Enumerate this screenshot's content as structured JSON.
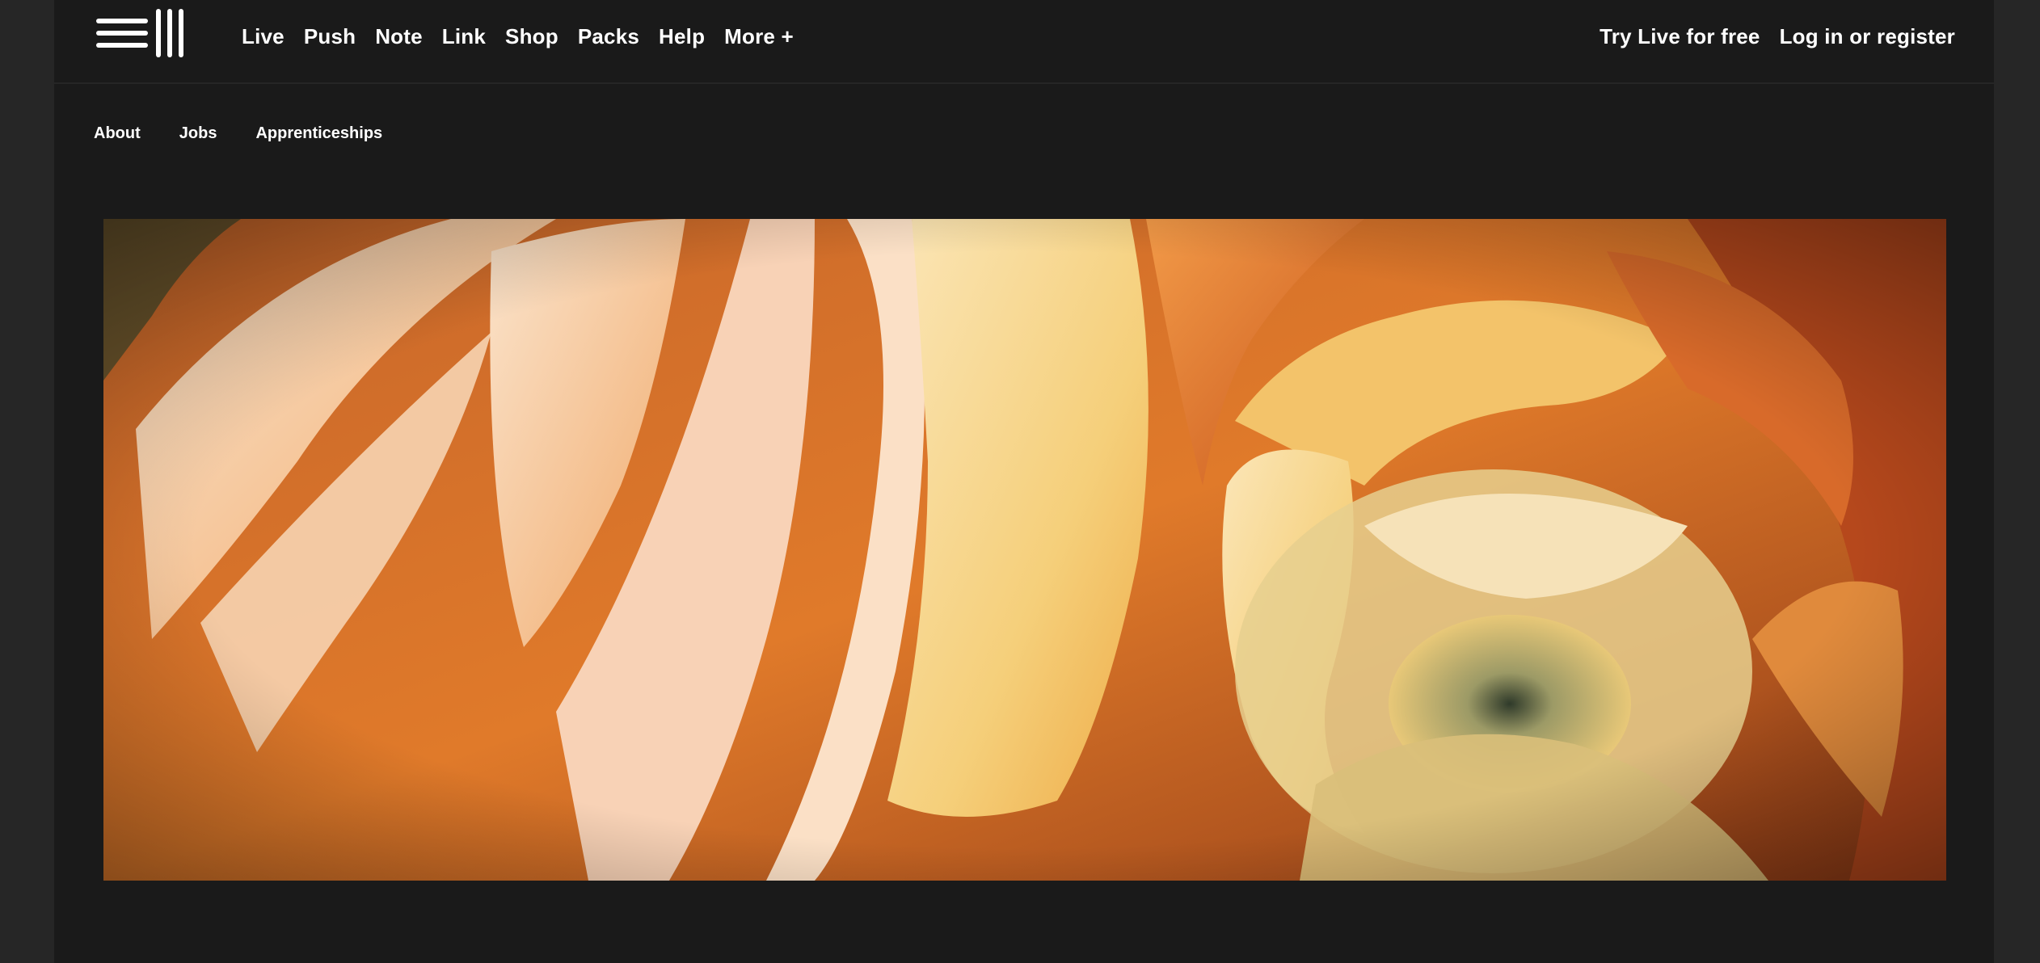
{
  "header": {
    "logo_icon": "ableton-logo-icon",
    "nav": [
      {
        "label": "Live"
      },
      {
        "label": "Push"
      },
      {
        "label": "Note"
      },
      {
        "label": "Link"
      },
      {
        "label": "Shop"
      },
      {
        "label": "Packs"
      },
      {
        "label": "Help"
      },
      {
        "label": "More +"
      }
    ],
    "try_live": "Try Live for free",
    "login": "Log in or register"
  },
  "subnav": {
    "items": [
      {
        "label": "About"
      },
      {
        "label": "Jobs"
      },
      {
        "label": "Apprenticeships"
      }
    ]
  },
  "hero": {
    "image_subject": "close-up of an orange and yellow ranunculus flower",
    "colors": {
      "deep_orange": "#b3481a",
      "orange": "#e07a2a",
      "light_peach": "#f7c99a",
      "cream": "#f6e2b8",
      "yellow": "#f2c44c",
      "shadow": "#3a2414"
    }
  },
  "colors": {
    "page_bg": "#1a1a1a",
    "outer_bg": "#262626",
    "text": "#ffffff"
  }
}
